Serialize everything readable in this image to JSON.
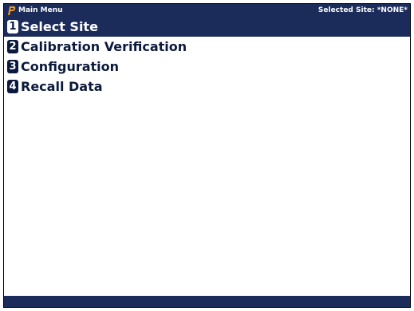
{
  "window": {
    "title": "Main Menu",
    "selected_site_label": "Selected Site:",
    "selected_site_value": "*NONE*",
    "logo_icon": "p-logo-icon"
  },
  "menu": {
    "items": [
      {
        "number": "1",
        "label": "Select Site",
        "selected": true
      },
      {
        "number": "2",
        "label": "Calibration Verification",
        "selected": false
      },
      {
        "number": "3",
        "label": "Configuration",
        "selected": false
      },
      {
        "number": "4",
        "label": "Recall Data",
        "selected": false
      }
    ]
  },
  "colors": {
    "bar_background": "#1b2b5a",
    "text_dark": "#0b1a3c",
    "logo_orange": "#f39a1c"
  }
}
